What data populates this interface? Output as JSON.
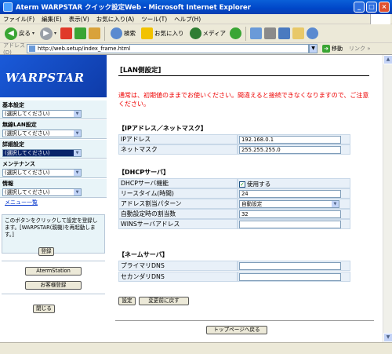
{
  "window": {
    "title": "Aterm WARPSTAR クイック設定Web - Microsoft Internet Explorer",
    "min": "_",
    "max": "□",
    "close": "×"
  },
  "menu": [
    "ファイル(F)",
    "編集(E)",
    "表示(V)",
    "お気に入り(A)",
    "ツール(T)",
    "ヘルプ(H)"
  ],
  "toolbar": {
    "back": "戻る",
    "search": "検索",
    "favorites": "お気に入り",
    "media": "メディア"
  },
  "address": {
    "label": "アドレス(D)",
    "url": "http://web.setup/index_frame.html",
    "go": "移動",
    "links": "リンク"
  },
  "nav": {
    "logo": "WARPSTAR",
    "sections": [
      {
        "label": "基本設定",
        "value": "(選択してください)"
      },
      {
        "label": "無線LAN設定",
        "value": "(選択してください)"
      },
      {
        "label": "詳細設定",
        "value": "(選択してください)",
        "selected": true
      },
      {
        "label": "メンテナンス",
        "value": "(選択してください)"
      },
      {
        "label": "情報",
        "value": "(選択してください)"
      }
    ],
    "menu_list": "メニュー一覧",
    "note": "このボタンをクリックして設定を登録します。[WARPSTAR(親機)を再起動します。]",
    "register": "登録",
    "aterm_station": "AtermStation",
    "customer_register": "お客様登録",
    "close": "閉じる"
  },
  "main": {
    "heading": "[LAN側設定]",
    "warning": "通常は、初期値のままでお使いください。間違えると接続できなくなりますので、ご注意ください。",
    "sections": {
      "ip": "【IPアドレス／ネットマスク】",
      "dhcp": "【DHCPサーバ】",
      "dns": "【ネームサーバ】"
    },
    "ip_rows": [
      {
        "label": "IPアドレス",
        "value": "192.168.0.1"
      },
      {
        "label": "ネットマスク",
        "value": "255.255.255.0"
      }
    ],
    "dhcp_rows": {
      "function": {
        "label": "DHCPサーバ機能",
        "value": "使用する"
      },
      "lease": {
        "label": "リースタイム(時間)",
        "value": "24"
      },
      "pattern": {
        "label": "アドレス割当パターン",
        "value": "自動設定"
      },
      "count": {
        "label": "自動設定時の割当数",
        "value": "32"
      },
      "wins": {
        "label": "WINSサーバアドレス",
        "value": ""
      }
    },
    "dns_rows": [
      {
        "label": "プライマリDNS",
        "value": ""
      },
      {
        "label": "セカンダリDNS",
        "value": ""
      }
    ],
    "buttons": {
      "set": "設定",
      "revert": "変更前に戻す",
      "top": "トップページへ戻る"
    }
  }
}
